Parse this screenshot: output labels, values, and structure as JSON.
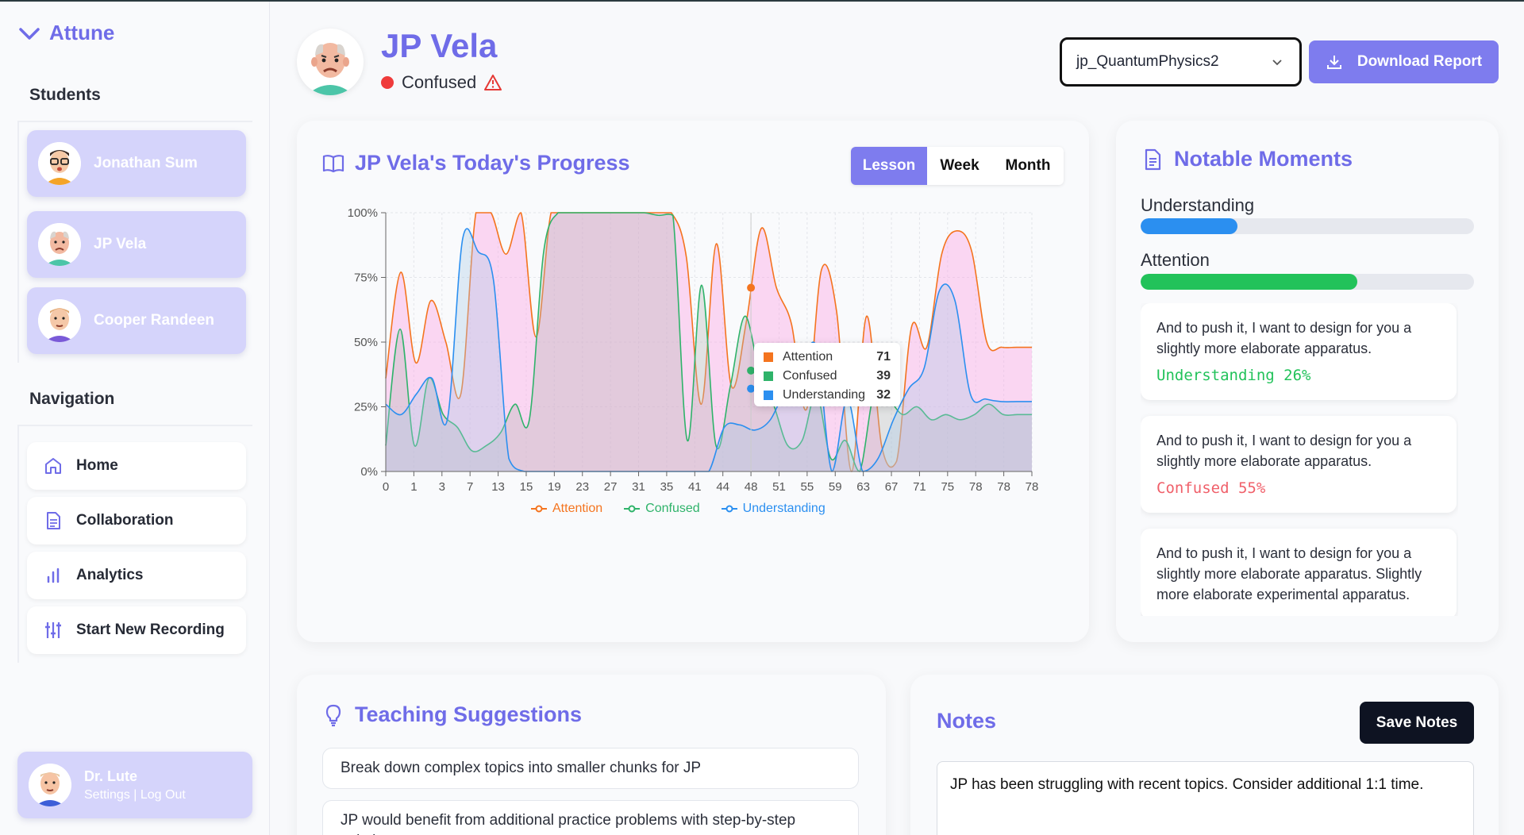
{
  "app": {
    "name": "Attune"
  },
  "sidebar": {
    "students_title": "Students",
    "students": [
      {
        "name": "Jonathan Sum"
      },
      {
        "name": "JP Vela"
      },
      {
        "name": "Cooper Randeen"
      }
    ],
    "navigation_title": "Navigation",
    "nav": [
      {
        "label": "Home",
        "icon": "home-icon"
      },
      {
        "label": "Collaboration",
        "icon": "document-icon"
      },
      {
        "label": "Analytics",
        "icon": "bar-chart-icon"
      },
      {
        "label": "Start New Recording",
        "icon": "sliders-icon"
      }
    ],
    "user": {
      "name": "Dr. Lute",
      "settings": "Settings",
      "separator": "|",
      "logout": "Log Out"
    }
  },
  "header": {
    "student_name": "JP Vela",
    "status": "Confused",
    "status_color": "#ef3b3b",
    "session_select": "jp_QuantumPhysics2",
    "download_label": "Download Report"
  },
  "progress": {
    "title": "JP Vela's Today's Progress",
    "tabs": [
      "Lesson",
      "Week",
      "Month"
    ],
    "active_tab": "Lesson",
    "tooltip": [
      {
        "name": "Attention",
        "value": "71",
        "color": "#f4741f"
      },
      {
        "name": "Confused",
        "value": "39",
        "color": "#2fb36a"
      },
      {
        "name": "Understanding",
        "value": "32",
        "color": "#2b8ff0"
      }
    ]
  },
  "chart_data": {
    "type": "area",
    "x_tick_labels": [
      "0",
      "1",
      "3",
      "7",
      "13",
      "15",
      "19",
      "23",
      "27",
      "31",
      "35",
      "41",
      "44",
      "48",
      "51",
      "55",
      "59",
      "63",
      "67",
      "71",
      "75",
      "78",
      "78",
      "78"
    ],
    "y_tick_labels": [
      "0%",
      "25%",
      "50%",
      "75%",
      "100%"
    ],
    "ylim": [
      0,
      100
    ],
    "legend_position": "bottom",
    "grid": true,
    "series": [
      {
        "name": "Attention",
        "color": "#f4741f",
        "values": [
          36,
          77,
          42,
          66,
          50,
          30,
          100,
          100,
          84,
          100,
          52,
          100,
          100,
          100,
          100,
          100,
          100,
          100,
          100,
          100,
          83,
          26,
          88,
          33,
          58,
          94,
          71,
          57,
          24,
          78,
          62,
          0,
          60,
          10,
          4,
          56,
          48,
          84,
          93,
          85,
          50,
          48,
          48,
          48
        ]
      },
      {
        "name": "Confused",
        "color": "#2fb36a",
        "values": [
          10,
          55,
          10,
          36,
          22,
          17,
          8,
          10,
          15,
          26,
          20,
          85,
          100,
          100,
          100,
          100,
          100,
          100,
          100,
          99,
          99,
          12,
          72,
          10,
          33,
          60,
          39,
          26,
          10,
          12,
          30,
          5,
          12,
          0,
          30,
          28,
          22,
          25,
          20,
          22,
          20,
          22,
          26,
          22,
          22,
          22
        ]
      },
      {
        "name": "Understanding",
        "color": "#2b8ff0",
        "values": [
          26,
          22,
          30,
          36,
          20,
          90,
          85,
          74,
          5,
          0,
          0,
          0,
          0,
          0,
          0,
          0,
          0,
          0,
          0,
          0,
          0,
          0,
          17,
          18,
          16,
          20,
          32,
          40,
          48,
          0,
          28,
          0,
          5,
          20,
          32,
          40,
          70,
          66,
          30,
          28,
          27,
          27,
          27
        ]
      }
    ],
    "tooltip_x": "48"
  },
  "moments": {
    "title": "Notable Moments",
    "metrics": [
      {
        "label": "Understanding",
        "value": 0.29,
        "color": "#2b8ff0"
      },
      {
        "label": "Attention",
        "value": 0.65,
        "color": "#22c25a"
      }
    ],
    "items": [
      {
        "text": "And to push it, I want to design for you a slightly more elaborate apparatus.",
        "tag": "Understanding 26%",
        "tag_color": "#22c25a"
      },
      {
        "text": "And to push it, I want to design for you a slightly more elaborate apparatus.",
        "tag": "Confused 55%",
        "tag_color": "#f0606a"
      },
      {
        "text": "And to push it, I want to design for you a slightly more elaborate apparatus. Slightly more elaborate experimental apparatus.",
        "tag": "",
        "tag_color": "#2b2f3a"
      }
    ]
  },
  "suggestions": {
    "title": "Teaching Suggestions",
    "items": [
      "Break down complex topics into smaller chunks for JP",
      "JP would benefit from additional practice problems with step-by-step solutions"
    ]
  },
  "notes": {
    "title": "Notes",
    "save_label": "Save Notes",
    "content": "JP has been struggling with recent topics. Consider additional 1:1 time."
  }
}
